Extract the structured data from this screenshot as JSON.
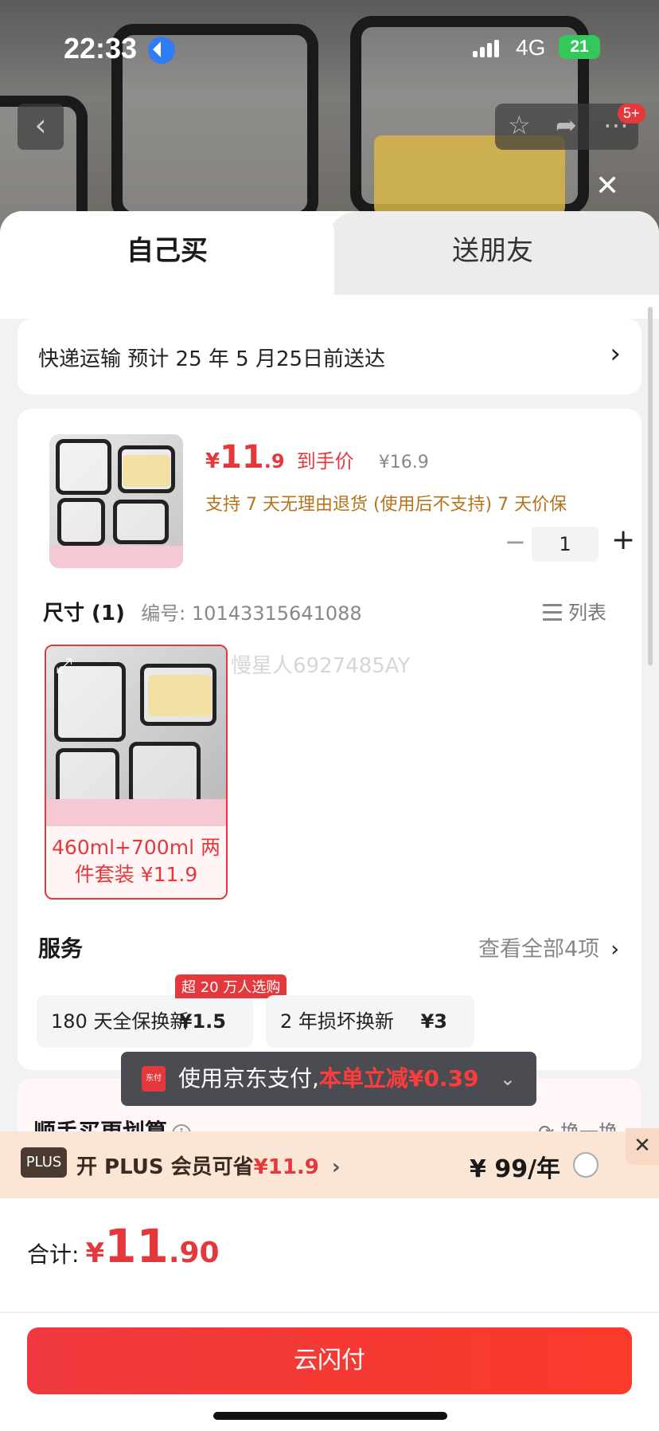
{
  "status_bar": {
    "time": "22:33",
    "network": "4G",
    "battery": "21"
  },
  "top_actions": {
    "badge": "5+"
  },
  "tabs": [
    {
      "label": "自己买",
      "active": true
    },
    {
      "label": "送朋友",
      "active": false
    }
  ],
  "shipping": {
    "text": "快递运输 预计 25 年 5 月25日前送达"
  },
  "product": {
    "price_symbol": "¥",
    "price_int": "11",
    "price_dec": ".9",
    "price_label": "到手价",
    "original_price": "¥16.9",
    "support_text": "支持 7 天无理由退货 (使用后不支持)  7 天价保",
    "quantity": "1",
    "size_label": "尺寸 (1)",
    "code_label": "编号:  10143315641088",
    "list_label": "列表",
    "variant_label": "460ml+700ml 两件套装 ¥11.9",
    "watermark": "慢星人6927485AY"
  },
  "services": {
    "title": "服务",
    "view_all": "查看全部4项",
    "hot_badge": "超 20 万人选购",
    "items": [
      {
        "name": "180 天全保换新",
        "price": "¥1.5"
      },
      {
        "name": "2 年损坏换新",
        "price": "¥3"
      }
    ]
  },
  "pay_tip": {
    "prefix": "使用京东支付,",
    "highlight": "本单立减¥0.39",
    "jd_icon_text": "东付"
  },
  "more": {
    "title": "顺手买更划算",
    "swap": "换一换"
  },
  "plus": {
    "badge": "PLUS",
    "text": "开 PLUS 会员可省",
    "save": "¥11.9",
    "price": "¥ 99/年"
  },
  "total": {
    "label": "合计:",
    "yen": "¥",
    "int": "11",
    "dec": ".90"
  },
  "pay_button": "云闪付",
  "colors": {
    "accent": "#e4393c",
    "support": "#b5731b",
    "plus_bg": "#fbe6d6"
  }
}
